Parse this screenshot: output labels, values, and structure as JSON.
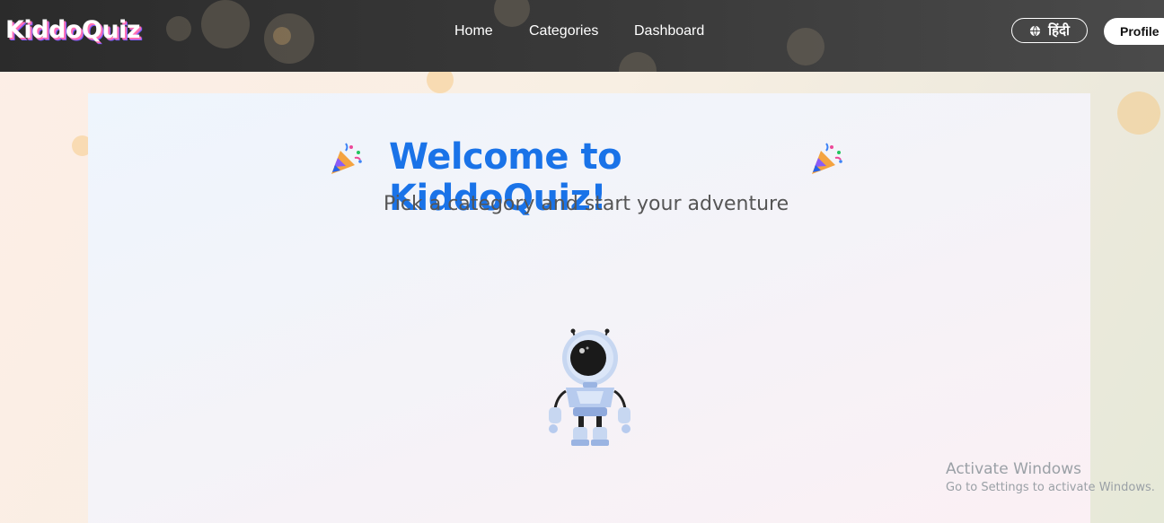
{
  "header": {
    "logo": "KiddoQuiz",
    "nav": [
      {
        "label": "Home"
      },
      {
        "label": "Categories"
      },
      {
        "label": "Dashboard"
      }
    ],
    "language_label": "हिंदी",
    "profile_label": "Profile"
  },
  "hero": {
    "title": "Welcome to KiddoQuiz!",
    "subtitle": "Pick a category and start your adventure"
  },
  "watermark": {
    "title": "Activate Windows",
    "subtitle": "Go to Settings to activate Windows."
  },
  "colors": {
    "accent": "#1a73e8",
    "nav_bg": "#2b2b2b"
  }
}
